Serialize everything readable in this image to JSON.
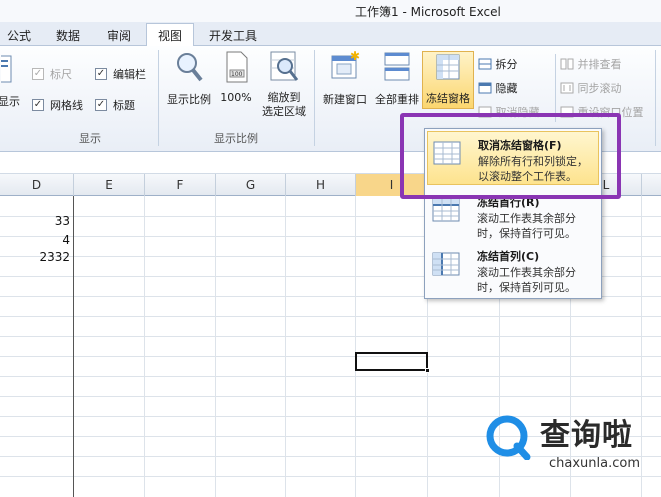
{
  "window": {
    "title": "工作簿1  -  Microsoft Excel"
  },
  "tabs": [
    {
      "label": "公式"
    },
    {
      "label": "数据"
    },
    {
      "label": "审阅"
    },
    {
      "label": "视图"
    },
    {
      "label": "开发工具"
    }
  ],
  "ribbon": {
    "show_group": {
      "partial_button": "显示",
      "ruler": "标尺",
      "formula_bar": "编辑栏",
      "gridlines": "网格线",
      "headings": "标题",
      "label": "显示"
    },
    "zoom_group": {
      "zoom": "显示比例",
      "zoom100": "100%",
      "zoom_selection_line1": "缩放到",
      "zoom_selection_line2": "选定区域",
      "label": "显示比例"
    },
    "window_group": {
      "new_window": "新建窗口",
      "arrange_all": "全部重排",
      "freeze_panes": "冻结窗格",
      "split": "拆分",
      "hide": "隐藏",
      "unhide": "取消隐藏",
      "side_by_side": "并排查看",
      "sync_scroll": "同步滚动",
      "reset_position": "重设窗口位置"
    }
  },
  "columns": [
    "D",
    "E",
    "F",
    "G",
    "H",
    "I",
    "L"
  ],
  "cells": {
    "d1": "33",
    "d2": "4",
    "d3": "2332"
  },
  "dropdown": {
    "items": [
      {
        "title": "取消冻结窗格(F)",
        "desc": "解除所有行和列锁定，以滚动整个工作表。"
      },
      {
        "title": "冻结首行(R)",
        "desc": "滚动工作表其余部分时，保持首行可见。"
      },
      {
        "title": "冻结首列(C)",
        "desc": "滚动工作表其余部分时，保持首列可见。"
      }
    ]
  },
  "watermark": {
    "name": "查询啦",
    "url": "chaxunla.com"
  },
  "colors": {
    "highlight": "#8a35b3",
    "accent": "#fde38e",
    "watermark_blue": "#1f8ee6"
  }
}
